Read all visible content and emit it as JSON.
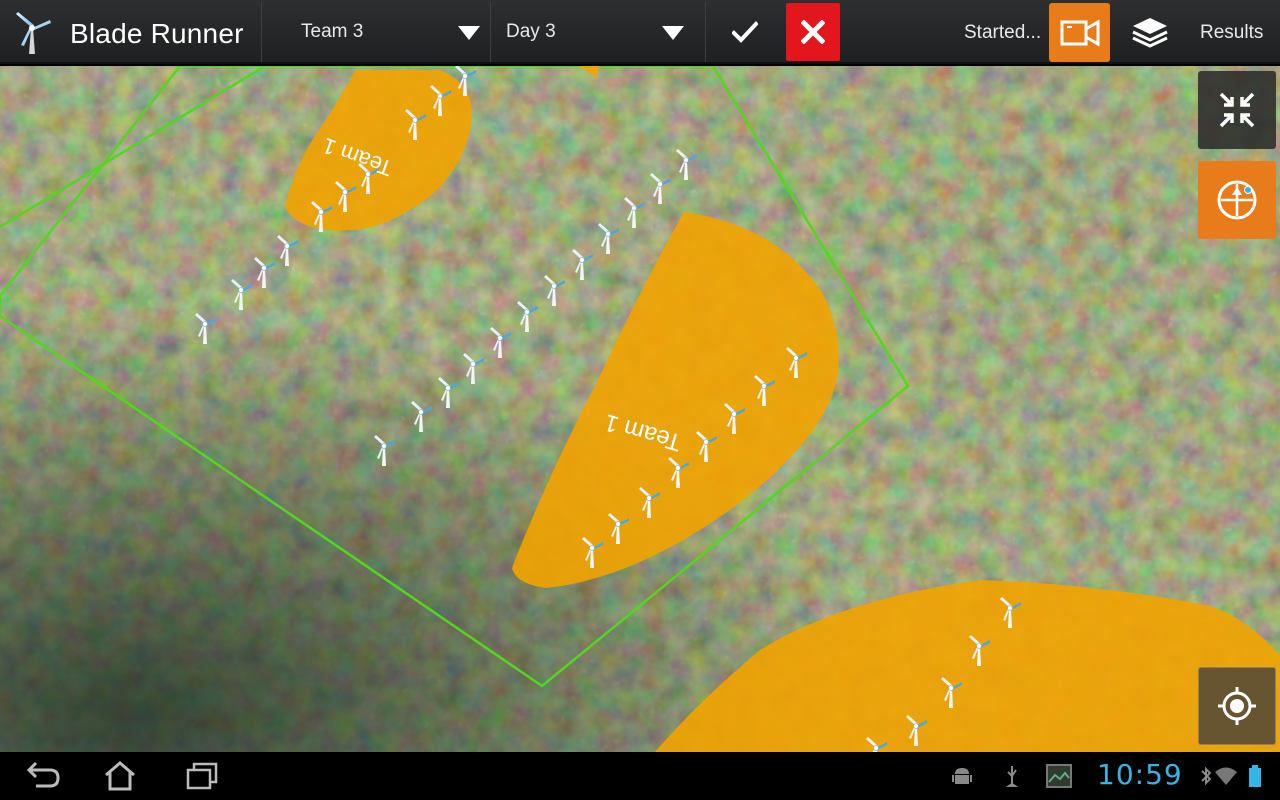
{
  "app": {
    "title": "Blade Runner",
    "icon": "wind-turbine-icon"
  },
  "toolbar": {
    "team_select": {
      "value": "Team 3",
      "icon": "caret-down-icon"
    },
    "day_select": {
      "value": "Day 3",
      "icon": "caret-down-icon"
    },
    "confirm_icon": "check-icon",
    "cancel_icon": "close-icon",
    "status_text": "Started...",
    "video_icon": "video-camera-icon",
    "layers_icon": "layers-icon",
    "results_label": "Results"
  },
  "map": {
    "survey_area_color": "#55d522",
    "team_zone_color": "#f2a300",
    "zone_labels": [
      "Team 1",
      "Team 1"
    ],
    "turbine_icon": "wind-turbine-icon",
    "controls": [
      "shrink-icon",
      "compass-icon",
      "my-location-icon"
    ]
  },
  "system_bar": {
    "nav": [
      "back-icon",
      "home-icon",
      "recent-apps-icon"
    ],
    "tray_icons": [
      "android-debug-icon",
      "usb-icon",
      "screenshot-icon",
      "bluetooth-icon",
      "wifi-icon",
      "battery-icon"
    ],
    "clock": "10:59",
    "accent_color": "#33b5e5"
  }
}
